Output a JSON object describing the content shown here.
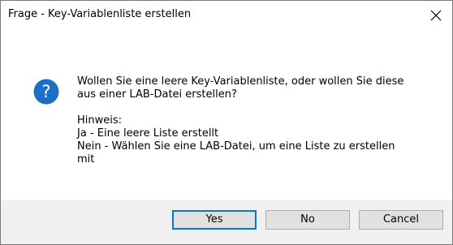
{
  "dialog": {
    "title": "Frage - Key-Variablenliste erstellen",
    "icon": "question-icon",
    "message": {
      "line1": "Wollen Sie eine leere Key-Variablenliste, oder wollen Sie diese",
      "line2": "aus einer LAB-Datei erstellen?",
      "hint_label": "Hinweis:",
      "hint_yes": "Ja - Eine leere Liste erstellt",
      "hint_no_line1": "Nein - Wählen Sie eine LAB-Datei, um eine Liste zu erstellen",
      "hint_no_line2": "mit"
    },
    "buttons": {
      "yes": "Yes",
      "no": "No",
      "cancel": "Cancel"
    },
    "colors": {
      "icon_blue": "#1c6fc4",
      "default_border": "#0078d7",
      "footer_bg": "#f0f0f0",
      "button_bg": "#e1e1e1"
    }
  }
}
